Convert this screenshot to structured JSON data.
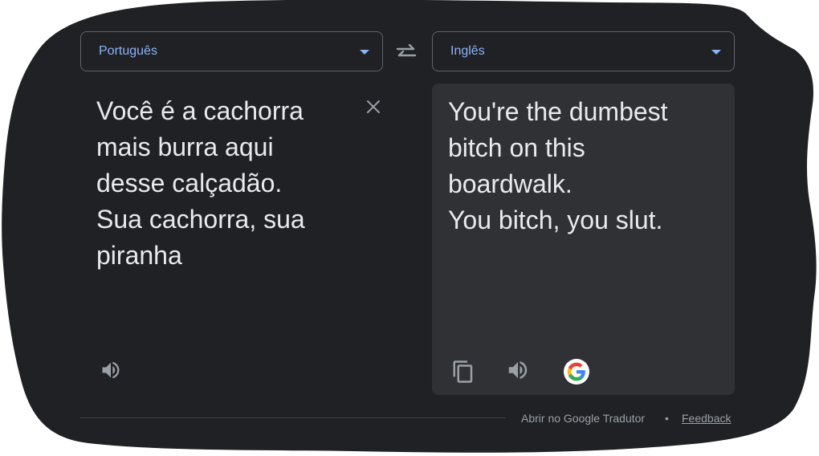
{
  "source_language": {
    "label": "Português"
  },
  "target_language": {
    "label": "Inglês"
  },
  "source_text": "Você é a cachorra\nmais burra aqui\ndesse calçadão.\nSua cachorra, sua\npiranha",
  "target_text": "You're the dumbest\nbitch on this\nboardwalk.\nYou bitch, you slut.",
  "footer": {
    "open_label": "Abrir no Google Tradutor",
    "separator": "•",
    "feedback_label": "Feedback"
  },
  "icons": {
    "swap": "swap-arrows-icon",
    "clear": "close-icon",
    "source_speaker": "speaker-icon",
    "copy": "copy-icon",
    "target_speaker": "speaker-icon",
    "google": "google-logo-icon"
  },
  "colors": {
    "background": "#202124",
    "panel": "#303134",
    "accent": "#8ab4f8",
    "text": "#e8eaed",
    "muted": "#9aa0a6"
  }
}
